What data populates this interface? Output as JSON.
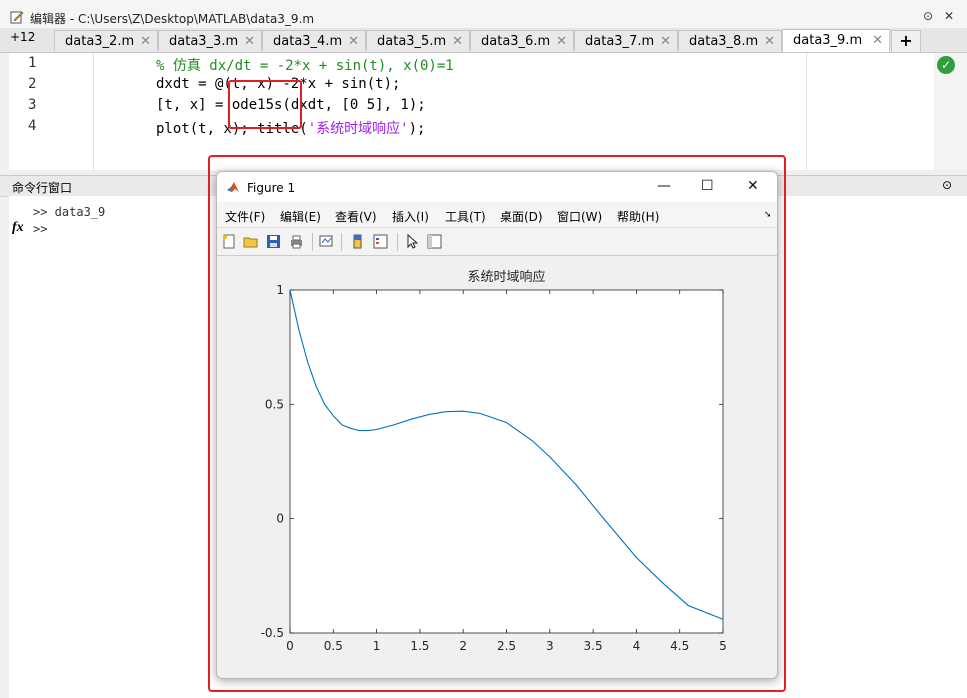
{
  "editor": {
    "title": "编辑器 - C:\\Users\\Z\\Desktop\\MATLAB\\data3_9.m",
    "tab_overflow": "+12",
    "tabs": [
      "data3_2.m",
      "data3_3.m",
      "data3_4.m",
      "data3_5.m",
      "data3_6.m",
      "data3_7.m",
      "data3_8.m",
      "data3_9.m"
    ],
    "active_tab": "data3_9.m",
    "add_tab": "+",
    "lines": [
      {
        "no": "1",
        "code": "% 仿真 dx/dt = -2*x + sin(t), x(0)=1"
      },
      {
        "no": "2",
        "code": "dxdt = @(t, x) -2*x + sin(t);"
      },
      {
        "no": "3",
        "code": "[t, x] = ode15s(dxdt, [0 5], 1);"
      },
      {
        "no": "4",
        "code_pre": "plot(t, x); title(",
        "code_str": "'系统时域响应'",
        "code_post": ");"
      }
    ]
  },
  "command_window": {
    "title": "命令行窗口",
    "history": ">> data3_9",
    "prompt": ">>",
    "fx": "fx"
  },
  "figure": {
    "title": "Figure 1",
    "menu": [
      "文件(F)",
      "编辑(E)",
      "查看(V)",
      "插入(I)",
      "工具(T)",
      "桌面(D)",
      "窗口(W)",
      "帮助(H)"
    ],
    "win_min": "—",
    "win_max": "☐",
    "win_close": "✕"
  },
  "chart_data": {
    "type": "line",
    "title": "系统时域响应",
    "xlabel": "",
    "ylabel": "",
    "xlim": [
      0,
      5
    ],
    "ylim": [
      -0.5,
      1
    ],
    "xticks": [
      0,
      0.5,
      1,
      1.5,
      2,
      2.5,
      3,
      3.5,
      4,
      4.5,
      5
    ],
    "yticks": [
      -0.5,
      0,
      0.5,
      1
    ],
    "grid": false,
    "color": "#0072BD",
    "x": [
      0,
      0.1,
      0.2,
      0.3,
      0.4,
      0.5,
      0.6,
      0.7,
      0.8,
      0.9,
      1.0,
      1.2,
      1.4,
      1.6,
      1.8,
      2.0,
      2.2,
      2.5,
      2.8,
      3.0,
      3.3,
      3.6,
      4.0,
      4.3,
      4.6,
      5.0
    ],
    "y": [
      1.0,
      0.83,
      0.69,
      0.58,
      0.5,
      0.45,
      0.41,
      0.395,
      0.385,
      0.385,
      0.39,
      0.41,
      0.435,
      0.455,
      0.468,
      0.47,
      0.46,
      0.42,
      0.34,
      0.27,
      0.15,
      0.01,
      -0.17,
      -0.28,
      -0.38,
      -0.44
    ]
  }
}
